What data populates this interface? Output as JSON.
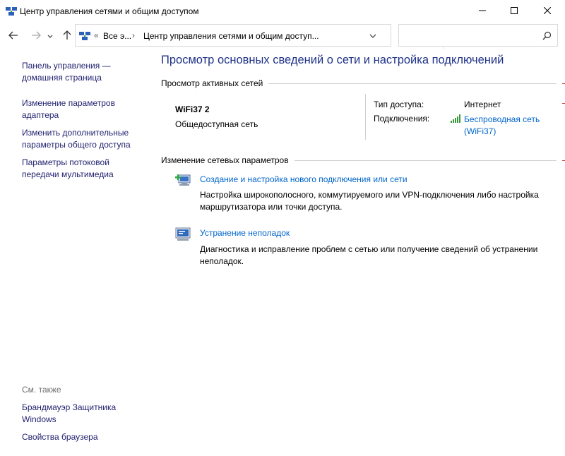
{
  "window": {
    "title": "Центр управления сетями и общим доступом",
    "icons": {
      "app": "network-center-icon",
      "minimize": "minimize-icon",
      "maximize": "maximize-icon",
      "close": "close-icon"
    }
  },
  "nav": {
    "back_icon": "arrow-left-icon",
    "forward_icon": "arrow-right-icon",
    "recent_icon": "chevron-down-icon",
    "up_icon": "arrow-up-icon",
    "address": {
      "separator": "«",
      "crumb1": "Все э...",
      "separator2": "›",
      "crumb2": "Центр управления сетями и общим доступ..."
    },
    "refresh_icon": "refresh-icon",
    "search": {
      "value": "",
      "placeholder": ""
    }
  },
  "sidebar": {
    "home_link": [
      "Панель управления —",
      "домашняя страница"
    ],
    "links": [
      [
        "Изменение параметров",
        "адаптера"
      ],
      [
        "Изменить дополнительные",
        "параметры общего доступа"
      ],
      [
        "Параметры потоковой",
        "передачи мультимедиа"
      ]
    ],
    "see_also_label": "См. также",
    "see_also_links": [
      [
        "Брандмауэр Защитника",
        "Windows"
      ],
      [
        "Свойства браузера"
      ]
    ]
  },
  "main": {
    "title": "Просмотр основных сведений о сети и настройка подключений",
    "active_header": "Просмотр активных сетей",
    "network": {
      "name": "WiFi37 2",
      "category": "Общедоступная сеть",
      "access_label": "Тип доступа:",
      "access_value": "Интернет",
      "connections_label": "Подключения:",
      "connection_link": [
        "Беспроводная сеть",
        "(WiFi37)"
      ],
      "connection_icon": "wifi-signal-icon"
    },
    "change_header": "Изменение сетевых параметров",
    "tasks": [
      {
        "icon": "new-connection-icon",
        "link": "Создание и настройка нового подключения или сети",
        "desc": [
          "Настройка широкополосного, коммутируемого или VPN-подключения либо настройка",
          "маршрутизатора или точки доступа."
        ]
      },
      {
        "icon": "troubleshoot-icon",
        "link": "Устранение неполадок",
        "desc": [
          "Диагностика и исправление проблем с сетью или получение сведений об устранении",
          "неполадок."
        ]
      }
    ]
  },
  "colors": {
    "link": "#0066cc",
    "title": "#1e3287",
    "sidebar_link": "#1f1f6e",
    "muted": "#6d6d6d"
  }
}
